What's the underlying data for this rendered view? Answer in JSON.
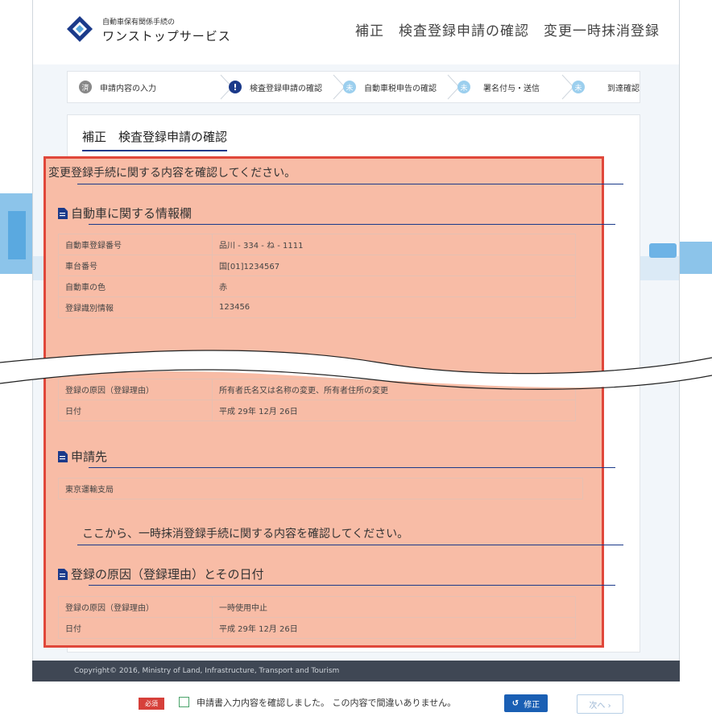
{
  "header": {
    "logo_small": "自動車保有関係手続の",
    "logo_big": "ワンストップサービス",
    "page_title": "補正　検査登録申請の確認　変更一時抹消登録"
  },
  "steps": [
    {
      "badge": "済",
      "label": "申請内容の入力"
    },
    {
      "badge": "!",
      "label": "検査登録申請の確認"
    },
    {
      "badge": "未",
      "label": "自動車税申告の確認"
    },
    {
      "badge": "未",
      "label": "署名付与・送信"
    },
    {
      "badge": "未",
      "label": "到達確認"
    }
  ],
  "card_title": "補正　検査登録申請の確認",
  "section1": {
    "heading": "変更登録手続に関する内容を確認してください。",
    "vehicle": {
      "title": "自動車に関する情報欄",
      "rows": [
        {
          "k": "自動車登録番号",
          "v": "品川 - 334 - ね - 1111"
        },
        {
          "k": "車台番号",
          "v": "国[01]1234567"
        },
        {
          "k": "自動車の色",
          "v": "赤"
        },
        {
          "k": "登録識別情報",
          "v": "123456"
        }
      ]
    },
    "reason": {
      "rows": [
        {
          "k": "登録の原因（登録理由）",
          "v": "所有者氏名又は名称の変更、所有者住所の変更"
        },
        {
          "k": "日付",
          "v": "平成 29年 12月 26日"
        }
      ]
    },
    "destination": {
      "title": "申請先",
      "value": "東京運輸支局"
    }
  },
  "section2": {
    "heading": "ここから、一時抹消登録手続に関する内容を確認してください。",
    "reason": {
      "title": "登録の原因（登録理由）とその日付",
      "rows": [
        {
          "k": "登録の原因（登録理由）",
          "v": "一時使用中止"
        },
        {
          "k": "日付",
          "v": "平成 29年 12月 26日"
        }
      ]
    }
  },
  "footer": {
    "copyright": "Copyright© 2016, Ministry of Land, Infrastructure, Transport and Tourism"
  },
  "bottom": {
    "required": "必須",
    "confirm_label": "申請書入力内容を確認しました。 この内容で間違いありません。",
    "fix_button": "修正",
    "next_button": "次へ ›"
  },
  "colors": {
    "accent": "#1b3a8a",
    "highlight_fill": "#f8bca6",
    "highlight_border": "#e0473a",
    "required": "#d6403a"
  }
}
